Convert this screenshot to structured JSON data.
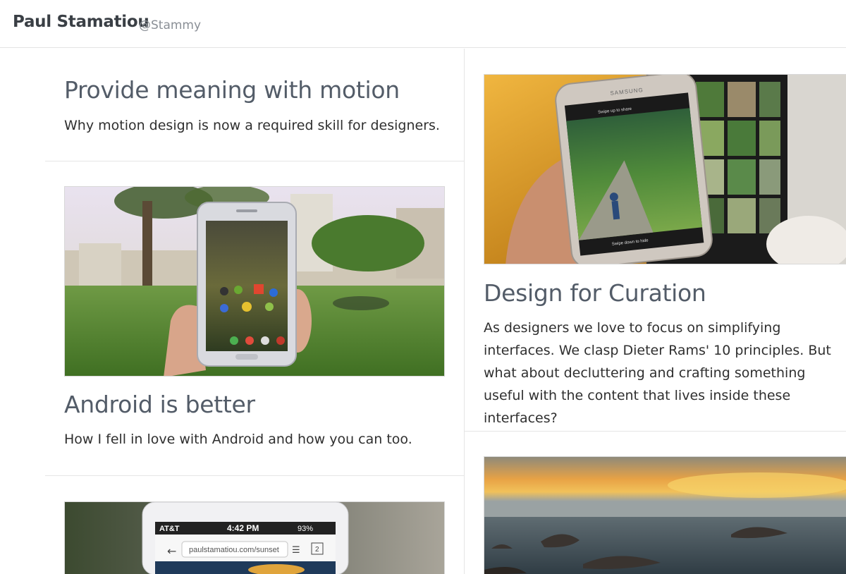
{
  "header": {
    "author": "Paul Stamatiou",
    "handle": "@Stammy"
  },
  "posts": {
    "motion": {
      "title": "Provide meaning with motion",
      "description": "Why motion design is now a required skill for designers."
    },
    "android": {
      "title": "Android is better",
      "description": "How I fell in love with Android and how you can too."
    },
    "curation": {
      "title": "Design for Curation",
      "description": "As designers we love to focus on simplifying interfaces. We clasp Dieter Rams' 10 principles. But what about decluttering and crafting something useful with the content that lives inside these interfaces?"
    }
  },
  "phone_screens": {
    "samsung_brand": "SAMSUNG",
    "swipe_share": "Swipe up to share",
    "swipe_hide": "Swipe down to hide",
    "carrier": "AT&T",
    "time": "4:42 PM",
    "battery": "93%",
    "url": "paulstamatiou.com/sunset",
    "tab_count": "2"
  }
}
